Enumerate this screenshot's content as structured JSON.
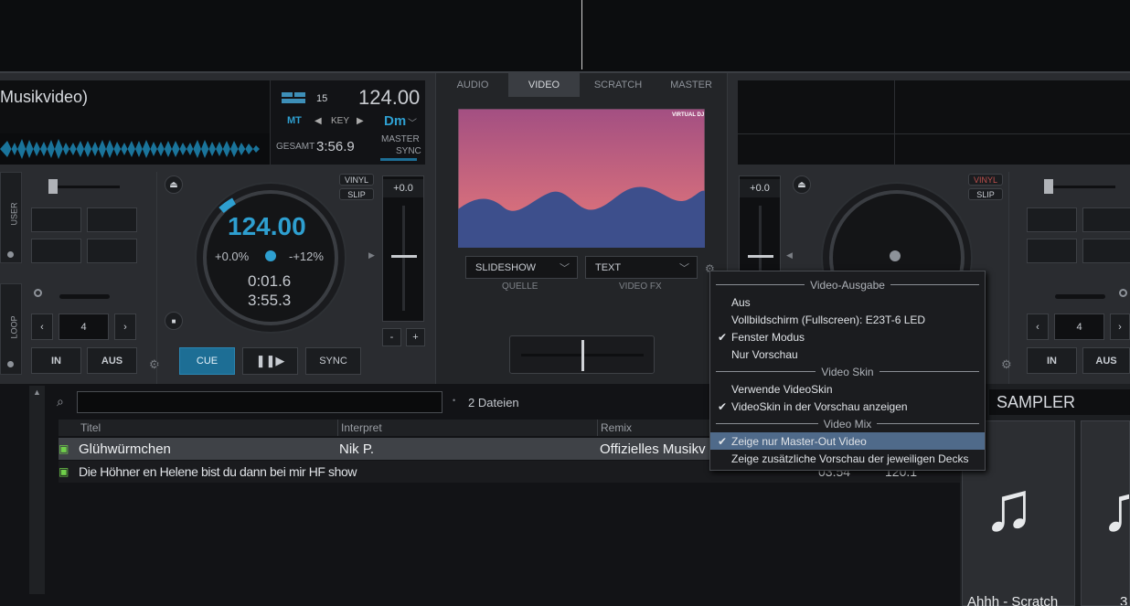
{
  "deckLeft": {
    "title": "Musikvideo)",
    "bpm": "124.00",
    "pitch_num": "15",
    "mt": "MT",
    "key_label": "KEY",
    "key": "Dm",
    "gesamt_label": "GESAMT",
    "gesamt": "3:56.9",
    "master_label": "MASTER",
    "sync_label": "SYNC",
    "vinyl": "VINYL",
    "slip": "SLIP",
    "pitch_val": "+0.0",
    "jog_bpm": "124.00",
    "jog_pitch": "+0.0%",
    "jog_range": "-+12%",
    "elapsed": "0:01.6",
    "remain": "3:55.3",
    "user": "USER",
    "loop": "LOOP",
    "loop_val": "4",
    "in": "IN",
    "aus": "AUS",
    "cue": "CUE",
    "sync": "SYNC"
  },
  "center": {
    "tabs": [
      "AUDIO",
      "VIDEO",
      "SCRATCH",
      "MASTER"
    ],
    "source": "SLIDESHOW",
    "source_label": "QUELLE",
    "fx": "TEXT",
    "fx_label": "VIDEO FX",
    "logo": "VIRTUAL DJ"
  },
  "deckRight": {
    "pitch_val": "+0.0",
    "vinyl": "VINYL",
    "slip": "SLIP",
    "loop_val": "4",
    "in": "IN",
    "aus": "AUS"
  },
  "browser": {
    "count": "2 Dateien",
    "col_title": "Titel",
    "col_artist": "Interpret",
    "col_remix": "Remix",
    "rows": [
      {
        "title": "Glühwürmchen",
        "artist": "Nik P.",
        "remix": "Offizielles Musikv"
      },
      {
        "title": "Die Höhner en Helene bist du dann bei mir HF show",
        "time": "03:54",
        "bpm": "120.1"
      }
    ]
  },
  "sampler": {
    "title": "SAMPLER",
    "item": "Ahhh - Scratch",
    "item2": "3"
  },
  "menu": {
    "h1": "Video-Ausgabe",
    "aus": "Aus",
    "fullscreen": "Vollbildschirm (Fullscreen): E23T-6 LED",
    "fenster": "Fenster Modus",
    "vorschau": "Nur Vorschau",
    "h2": "Video Skin",
    "verwende": "Verwende VideoSkin",
    "skin_vorschau": "VideoSkin in der Vorschau anzeigen",
    "h3": "Video Mix",
    "master_only": "Zeige nur Master-Out Video",
    "decks_preview": "Zeige zusätzliche Vorschau der jeweiligen Decks",
    "check": "✔"
  },
  "colors": {
    "accent": "#2e9fd0",
    "cue": "#1d6e95",
    "menu_hl": "#4f6a8a"
  }
}
